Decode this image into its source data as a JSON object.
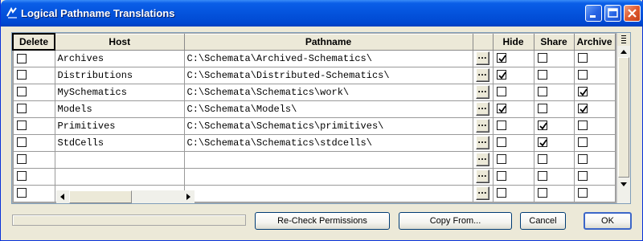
{
  "window": {
    "title": "Logical Pathname Translations",
    "controls": [
      "minimize-icon",
      "maximize-icon",
      "close-icon"
    ]
  },
  "table": {
    "columns": {
      "delete": "Delete",
      "host": "Host",
      "pathname": "Pathname",
      "browse": "",
      "hide": "Hide",
      "share": "Share",
      "archive": "Archive"
    },
    "browse_label": "...",
    "rows": [
      {
        "delete": false,
        "host": "Archives",
        "pathname": "C:\\Schemata\\Archived-Schematics\\",
        "hide": true,
        "share": false,
        "archive": false
      },
      {
        "delete": false,
        "host": "Distributions",
        "pathname": "C:\\Schemata\\Distributed-Schematics\\",
        "hide": true,
        "share": false,
        "archive": false
      },
      {
        "delete": false,
        "host": "MySchematics",
        "pathname": "C:\\Schemata\\Schematics\\work\\",
        "hide": false,
        "share": false,
        "archive": true
      },
      {
        "delete": false,
        "host": "Models",
        "pathname": "C:\\Schemata\\Models\\",
        "hide": true,
        "share": false,
        "archive": true
      },
      {
        "delete": false,
        "host": "Primitives",
        "pathname": "C:\\Schemata\\Schematics\\primitives\\",
        "hide": false,
        "share": true,
        "archive": false
      },
      {
        "delete": false,
        "host": "StdCells",
        "pathname": "C:\\Schemata\\Schematics\\stdcells\\",
        "hide": false,
        "share": true,
        "archive": false
      },
      {
        "delete": false,
        "host": "",
        "pathname": "",
        "hide": false,
        "share": false,
        "archive": false
      },
      {
        "delete": false,
        "host": "",
        "pathname": "",
        "hide": false,
        "share": false,
        "archive": false
      },
      {
        "delete": false,
        "host": "",
        "pathname": "",
        "hide": false,
        "share": false,
        "archive": false
      }
    ]
  },
  "buttons": {
    "recheck": "Re-Check Permissions",
    "copy_from": "Copy From...",
    "cancel": "Cancel",
    "ok": "OK"
  },
  "colors": {
    "titlebar": "#0453dc",
    "window_bg": "#ece9d8",
    "close_button": "#e05a2e"
  }
}
